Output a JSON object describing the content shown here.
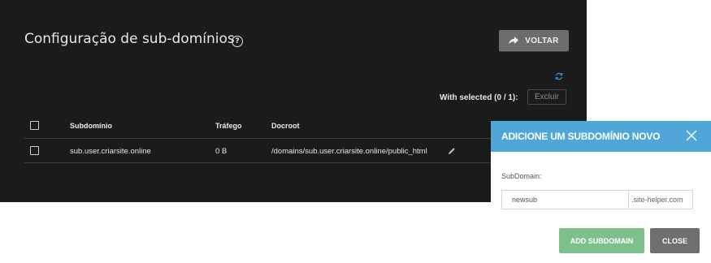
{
  "page": {
    "title": "Configuração de sub-domínios",
    "help_icon_glyph": "?",
    "back_button_label": "VOLTAR",
    "with_selected": "With selected (0 / 1):",
    "delete_button_label": "Excluir"
  },
  "table": {
    "headers": [
      "Subdomínio",
      "Tráfego",
      "Docroot"
    ],
    "rows": [
      {
        "subdomain": "sub.user.criarsite.online",
        "traffic": "0 B",
        "docroot": "/domains/sub.user.criarsite.online/public_html"
      }
    ]
  },
  "modal": {
    "title": "ADICIONE UM SUBDOMÍNIO NOVO",
    "field_label": "SubDomain:",
    "input_value": "newsub",
    "domain_suffix": ".site-helper.com",
    "add_button_label": "ADD SUBDOMAIN",
    "close_button_label": "CLOSE"
  },
  "colors": {
    "panel_bg": "#1b1b1b",
    "modal_header": "#4ea7d8",
    "add_button": "#7ec08c",
    "close_button": "#6f6f6f",
    "refresh_icon": "#3a8fd0"
  },
  "icons": [
    "help-icon",
    "arrow-share-icon",
    "refresh-icon",
    "pencil-icon",
    "close-icon"
  ]
}
